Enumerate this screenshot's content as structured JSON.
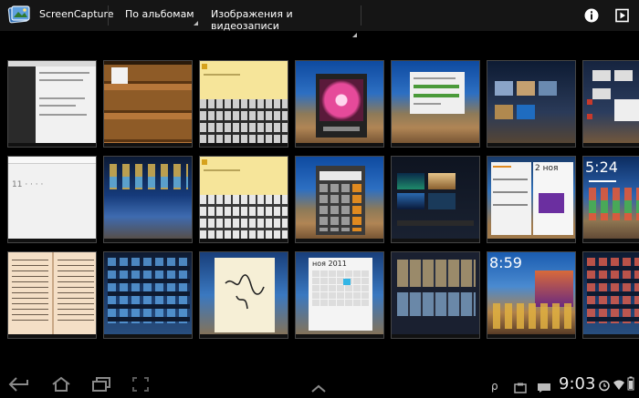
{
  "app": {
    "title": "ScreenCapture",
    "album_spinner": "По альбомам",
    "media_spinner": "Изображения и видеозаписи"
  },
  "colors": {
    "actionbar_bg": "#151515",
    "background": "#000000",
    "accent": "#33b5e5"
  },
  "icons": {
    "app": "gallery-app-icon",
    "info": "info-icon",
    "play": "slideshow-play-icon",
    "back": "back-icon",
    "home": "home-icon",
    "recent": "recent-apps-icon",
    "screenshot": "screenshot-icon",
    "menu_up": "chevron-up-icon"
  },
  "thumbnails": [
    {
      "row": 1,
      "col": 1,
      "kind": "settings",
      "content": "settings screen"
    },
    {
      "row": 1,
      "col": 2,
      "kind": "bookshelf",
      "content": "bookshelf"
    },
    {
      "row": 1,
      "col": 3,
      "kind": "memo-keyboard",
      "content": "memo with keyboard"
    },
    {
      "row": 1,
      "col": 4,
      "kind": "flower-dialog",
      "content": "photo viewer dialog"
    },
    {
      "row": 1,
      "col": 5,
      "kind": "dialog",
      "content": "download dialog"
    },
    {
      "row": 1,
      "col": 6,
      "kind": "recent-apps",
      "content": "recent apps"
    },
    {
      "row": 1,
      "col": 7,
      "kind": "notifications",
      "content": "notifications"
    },
    {
      "row": 2,
      "col": 1,
      "kind": "white-list",
      "content": "list"
    },
    {
      "row": 2,
      "col": 2,
      "kind": "home-icons",
      "content": "home screen"
    },
    {
      "row": 2,
      "col": 3,
      "kind": "memo-keyboard",
      "content": "memo with keyboard"
    },
    {
      "row": 2,
      "col": 4,
      "kind": "calculator",
      "content": "calculator"
    },
    {
      "row": 2,
      "col": 5,
      "kind": "wallpapers",
      "content": "wallpaper picker"
    },
    {
      "row": 2,
      "col": 6,
      "kind": "calendar-widget",
      "content": "2 ноя",
      "label": "2 ноя"
    },
    {
      "row": 2,
      "col": 7,
      "kind": "clock-home",
      "content": "5:24",
      "label": "5:24"
    },
    {
      "row": 3,
      "col": 1,
      "kind": "book",
      "content": "open book"
    },
    {
      "row": 3,
      "col": 2,
      "kind": "app-grid",
      "content": "apps"
    },
    {
      "row": 3,
      "col": 3,
      "kind": "handwriting",
      "content": "handwriting memo"
    },
    {
      "row": 3,
      "col": 4,
      "kind": "calendar",
      "content": "ноя 2011",
      "label": "ноя 2011"
    },
    {
      "row": 3,
      "col": 5,
      "kind": "gallery",
      "content": "gallery"
    },
    {
      "row": 3,
      "col": 6,
      "kind": "clock-home",
      "content": "8:59",
      "label": "8:59"
    },
    {
      "row": 3,
      "col": 7,
      "kind": "app-grid",
      "content": "apps"
    }
  ],
  "statusbar": {
    "time": "9:03"
  }
}
